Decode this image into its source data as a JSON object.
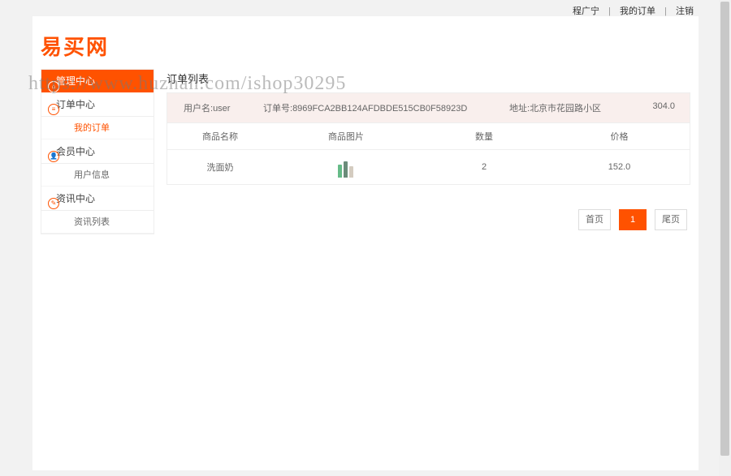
{
  "topbar": {
    "user": "程广宁",
    "my_orders": "我的订单",
    "logout": "注销"
  },
  "logo": "易买网",
  "watermark": "https://www.huzhan.com/ishop30295",
  "sidebar": {
    "header": "管理中心",
    "sections": [
      {
        "label": "订单中心",
        "items": [
          {
            "label": "我的订单",
            "active": true
          }
        ]
      },
      {
        "label": "会员中心",
        "items": [
          {
            "label": "用户信息",
            "active": false
          }
        ]
      },
      {
        "label": "资讯中心",
        "items": [
          {
            "label": "资讯列表",
            "active": false
          }
        ]
      }
    ]
  },
  "panel": {
    "title": "订单列表",
    "order_head": {
      "user_label": "用户名:",
      "user_value": "user",
      "order_label": "订单号:",
      "order_value": "8969FCA2BB124AFDBDE515CB0F58923D",
      "addr_label": "地址:",
      "addr_value": "北京市花园路小区",
      "total": "304.0"
    },
    "columns": {
      "name": "商品名称",
      "img": "商品图片",
      "qty": "数量",
      "price": "价格"
    },
    "rows": [
      {
        "name": "洗面奶",
        "qty": "2",
        "price": "152.0"
      }
    ]
  },
  "pagination": {
    "first": "首页",
    "current": "1",
    "last": "尾页"
  }
}
